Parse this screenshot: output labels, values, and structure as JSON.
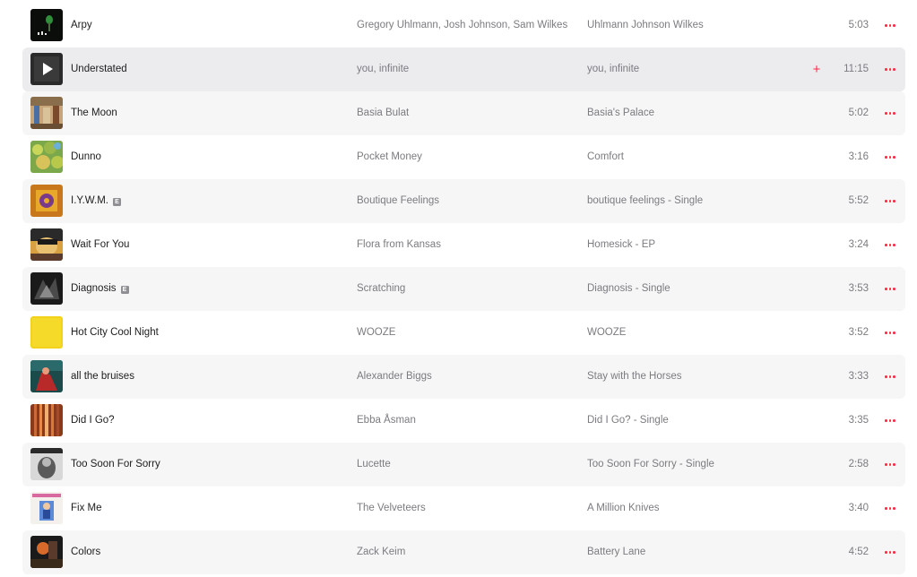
{
  "tracks": [
    {
      "title": "Arpy",
      "explicit": false,
      "artist": "Gregory Uhlmann, Josh Johnson, Sam Wilkes",
      "album": "Uhlmann Johnson Wilkes",
      "duration": "5:03",
      "art": "arpy-cover"
    },
    {
      "title": "Understated",
      "explicit": false,
      "artist": "you, infinite",
      "album": "you, infinite",
      "duration": "11:15",
      "art": "understated-cover",
      "hover": true,
      "add_symbol": "+"
    },
    {
      "title": "The Moon",
      "explicit": false,
      "artist": "Basia Bulat",
      "album": "Basia's Palace",
      "duration": "5:02",
      "art": "the-moon-cover"
    },
    {
      "title": "Dunno",
      "explicit": false,
      "artist": "Pocket Money",
      "album": "Comfort",
      "duration": "3:16",
      "art": "dunno-cover"
    },
    {
      "title": "I.Y.W.M.",
      "explicit": true,
      "artist": "Boutique Feelings",
      "album": "boutique feelings - Single",
      "duration": "5:52",
      "art": "iywm-cover"
    },
    {
      "title": "Wait For You",
      "explicit": false,
      "artist": "Flora from Kansas",
      "album": "Homesick - EP",
      "duration": "3:24",
      "art": "wait-for-you-cover"
    },
    {
      "title": "Diagnosis",
      "explicit": true,
      "artist": "Scratching",
      "album": "Diagnosis - Single",
      "duration": "3:53",
      "art": "diagnosis-cover"
    },
    {
      "title": "Hot City Cool Night",
      "explicit": false,
      "artist": "WOOZE",
      "album": "WOOZE",
      "duration": "3:52",
      "art": "wooze-cover"
    },
    {
      "title": "all the bruises",
      "explicit": false,
      "artist": "Alexander Biggs",
      "album": "Stay with the Horses",
      "duration": "3:33",
      "art": "all-the-bruises-cover"
    },
    {
      "title": "Did I Go?",
      "explicit": false,
      "artist": "Ebba Åsman",
      "album": "Did I Go? - Single",
      "duration": "3:35",
      "art": "did-i-go-cover"
    },
    {
      "title": "Too Soon For Sorry",
      "explicit": false,
      "artist": "Lucette",
      "album": "Too Soon For Sorry - Single",
      "duration": "2:58",
      "art": "too-soon-cover"
    },
    {
      "title": "Fix Me",
      "explicit": false,
      "artist": "The Velveteers",
      "album": "A Million Knives",
      "duration": "3:40",
      "art": "fix-me-cover"
    },
    {
      "title": "Colors",
      "explicit": false,
      "artist": "Zack Keim",
      "album": "Battery Lane",
      "duration": "4:52",
      "art": "colors-cover"
    }
  ],
  "explicit_badge": "E",
  "colors": {
    "accent": "#fa2d48",
    "row_alt": "#f6f6f7",
    "row_hover": "#ececee",
    "text_primary": "#1d1d1f",
    "text_secondary": "#7b7b80"
  },
  "icons": {
    "more": "ellipsis-icon",
    "add": "plus-icon",
    "play": "play-icon",
    "explicit": "explicit-badge-icon"
  }
}
